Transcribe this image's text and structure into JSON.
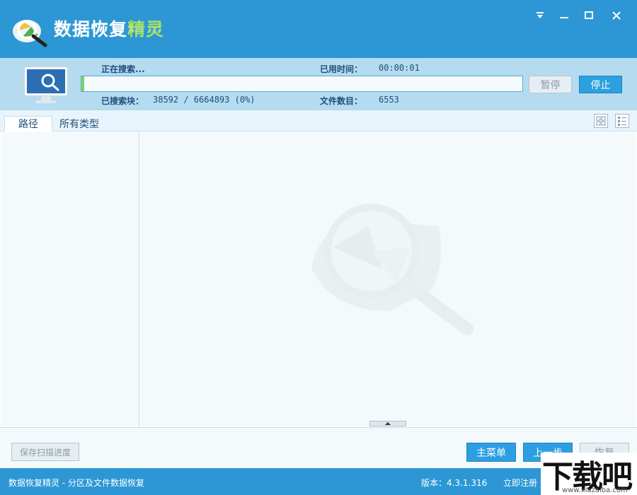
{
  "app": {
    "title_main": "数据恢复",
    "title_accent": "精灵"
  },
  "scan": {
    "status_label": "正在搜索...",
    "elapsed_label": "已用时间：",
    "elapsed_value": "00:00:01",
    "blocks_label": "已搜索块：",
    "blocks_value": "38592 / 6664893 (0%)",
    "files_label": "文件数目：",
    "files_value": "6553",
    "progress_fraction": 0.006,
    "pause_label": "暂停",
    "stop_label": "停止"
  },
  "tabs": [
    {
      "label": "路径"
    },
    {
      "label": "所有类型"
    }
  ],
  "buttons": {
    "save_progress": "保存扫描进度",
    "main_menu": "主菜单",
    "previous": "上一步",
    "recover": "恢复"
  },
  "statusbar": {
    "description": "数据恢复精灵 - 分区及文件数据恢复",
    "version": "版本：4.3.1.316",
    "register": "立即注册"
  },
  "watermark_brand": {
    "big": "下载吧",
    "small": "www.xiazaiba.com"
  },
  "colors": {
    "primary": "#2c97d4",
    "panel": "#b4dbf0",
    "accent_green": "#a6e05a",
    "button_blue": "#2c9fe0"
  }
}
